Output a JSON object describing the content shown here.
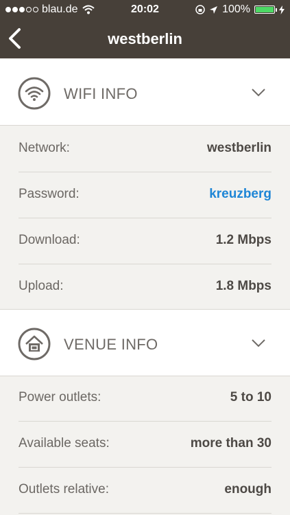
{
  "status_bar": {
    "carrier": "blau.de",
    "time": "20:02",
    "battery": "100%"
  },
  "nav": {
    "title": "westberlin",
    "back_icon": "chevron-left-icon"
  },
  "wifi_section": {
    "title": "WIFI INFO",
    "icon": "wifi-icon",
    "rows": [
      {
        "label": "Network:",
        "value": "westberlin"
      },
      {
        "label": "Password:",
        "value": "kreuzberg"
      },
      {
        "label": "Download:",
        "value": "1.2 Mbps"
      },
      {
        "label": "Upload:",
        "value": "1.8 Mbps"
      }
    ]
  },
  "venue_section": {
    "title": "VENUE INFO",
    "icon": "house-icon",
    "rows": [
      {
        "label": "Power outlets:",
        "value": "5 to 10"
      },
      {
        "label": "Available seats:",
        "value": "more than 30"
      },
      {
        "label": "Outlets relative:",
        "value": "enough"
      }
    ]
  },
  "colors": {
    "bar": "#474039",
    "link": "#1f86d6",
    "background": "#f3f2ef"
  }
}
